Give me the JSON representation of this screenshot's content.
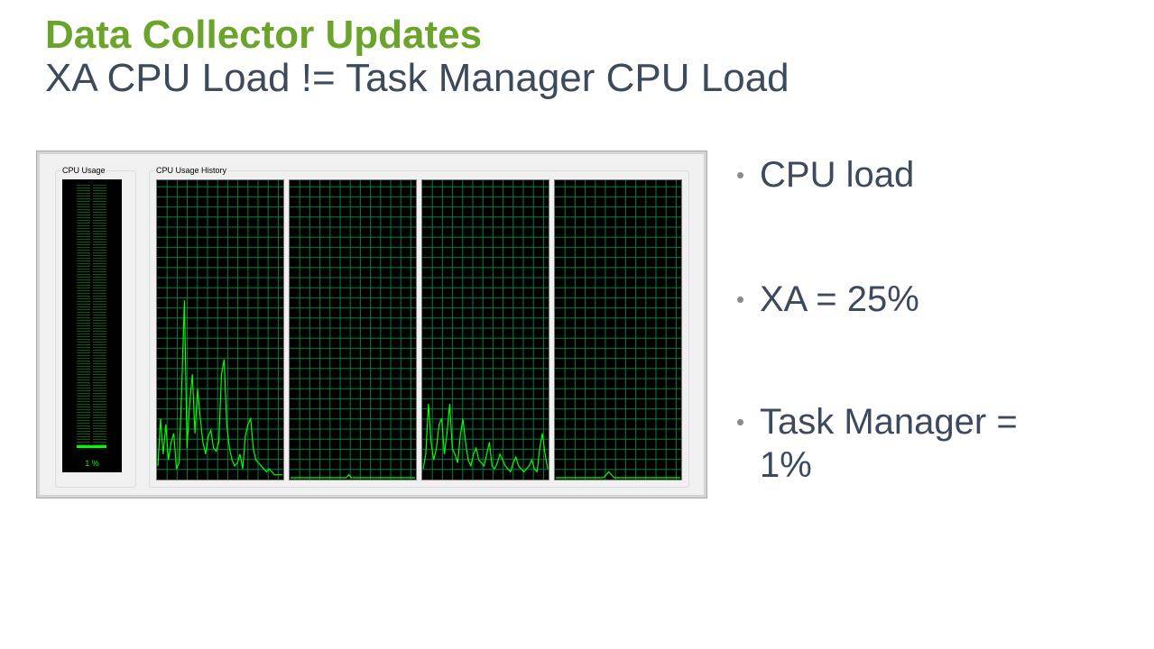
{
  "slide": {
    "title": "Data Collector Updates",
    "subtitle": "XA CPU Load != Task Manager CPU Load"
  },
  "task_manager": {
    "cpu_usage_label": "CPU Usage",
    "cpu_usage_value": "1 %",
    "cpu_usage_fraction": 0.01,
    "history_label": "CPU Usage History",
    "graph_color": "#00ff00",
    "grid_color": "#008040",
    "history_percent": [
      [
        4,
        20,
        8,
        18,
        6,
        12,
        15,
        3,
        5,
        30,
        60,
        10,
        25,
        35,
        15,
        30,
        20,
        12,
        8,
        14,
        16,
        10,
        9,
        12,
        35,
        40,
        18,
        10,
        6,
        4,
        5,
        8,
        3,
        14,
        18,
        20,
        10,
        6,
        5,
        4,
        3,
        2,
        3,
        2,
        1,
        1,
        1,
        1
      ],
      [
        0,
        0,
        0,
        0,
        0,
        0,
        0,
        0,
        0,
        0,
        0,
        0,
        0,
        0,
        0,
        0,
        0,
        0,
        0,
        0,
        0,
        0,
        1,
        0,
        0,
        0,
        0,
        0,
        0,
        0,
        0,
        0,
        0,
        0,
        0,
        0,
        0,
        0,
        0,
        0,
        0,
        0,
        0,
        0,
        0,
        0,
        0,
        0
      ],
      [
        3,
        8,
        25,
        12,
        6,
        10,
        18,
        20,
        8,
        15,
        25,
        10,
        8,
        5,
        14,
        20,
        12,
        6,
        4,
        8,
        10,
        6,
        5,
        4,
        8,
        12,
        4,
        3,
        5,
        8,
        6,
        4,
        3,
        2,
        5,
        7,
        4,
        3,
        2,
        3,
        4,
        6,
        3,
        2,
        10,
        15,
        8,
        3
      ],
      [
        0,
        0,
        0,
        0,
        0,
        0,
        0,
        0,
        0,
        0,
        0,
        0,
        0,
        0,
        0,
        0,
        0,
        0,
        0,
        1,
        2,
        1,
        0,
        0,
        0,
        0,
        0,
        0,
        0,
        0,
        0,
        0,
        0,
        0,
        0,
        0,
        0,
        0,
        0,
        0,
        0,
        0,
        0,
        0,
        0,
        0,
        0,
        0
      ]
    ]
  },
  "bullets": [
    "CPU load",
    "XA = 25%",
    "Task Manager = 1%"
  ]
}
